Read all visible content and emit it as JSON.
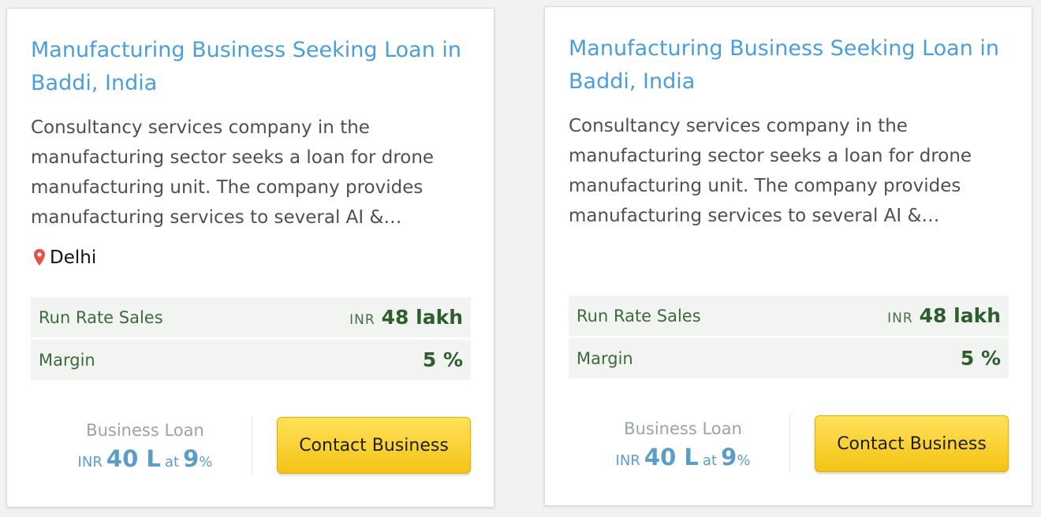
{
  "colors": {
    "title": "#4a9fd9",
    "stats_text": "#3e6b3c",
    "stats_bg": "#f2f4f2",
    "loan_text": "#5b9dc9",
    "button_bg": "#f7cb22",
    "pin": "#e3524a"
  },
  "icons": {
    "location": "map-pin-icon"
  },
  "cards": [
    {
      "title": "Manufacturing Business Seeking Loan in Baddi, India",
      "description": "Consultancy services company in the manufacturing sector seeks a loan for drone manufacturing unit. The company provides manufacturing services to several AI &…",
      "location": "Delhi",
      "stats": [
        {
          "label": "Run Rate Sales",
          "unit": "INR",
          "value": "48 lakh"
        },
        {
          "label": "Margin",
          "unit": "",
          "value": "5 %"
        }
      ],
      "loan": {
        "label": "Business Loan",
        "currency": "INR",
        "amount": "40 L",
        "at": "at",
        "rate": "9",
        "rate_unit": "%"
      },
      "button_label": "Contact Business"
    },
    {
      "title": "Manufacturing Business Seeking Loan in Baddi, India",
      "description": "Consultancy services company in the manufacturing sector seeks a loan for drone manufacturing unit. The company provides manufacturing services to several AI &…",
      "stats": [
        {
          "label": "Run Rate Sales",
          "unit": "INR",
          "value": "48 lakh"
        },
        {
          "label": "Margin",
          "unit": "",
          "value": "5 %"
        }
      ],
      "loan": {
        "label": "Business Loan",
        "currency": "INR",
        "amount": "40 L",
        "at": "at",
        "rate": "9",
        "rate_unit": "%"
      },
      "button_label": "Contact Business"
    }
  ]
}
